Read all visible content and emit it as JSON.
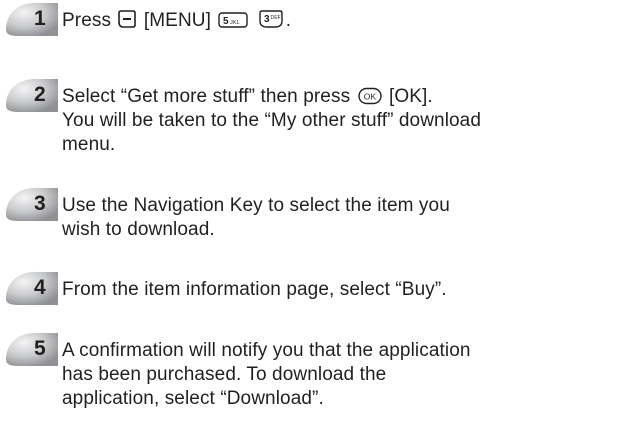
{
  "steps": [
    {
      "number": "1",
      "segments": {
        "before": "Press",
        "menu_label": "[MENU]",
        "end": "."
      },
      "keys": [
        "left-soft-key-icon",
        "5-jkl-key-icon",
        "3-def-key-icon"
      ],
      "key_glyphs": {
        "five": "5",
        "five_letters": "JKL",
        "three": "3",
        "three_letters": "DEF"
      }
    },
    {
      "number": "2",
      "segments": {
        "before": "Select “Get more stuff” then press",
        "ok_glyph": "OK",
        "after": "[OK]."
      },
      "lines": [
        "You will be taken to the “My other stuff” download",
        "menu."
      ],
      "keys": [
        "ok-key-icon"
      ]
    },
    {
      "number": "3",
      "lines": [
        "Use the Navigation Key to select the item you",
        "wish to download."
      ]
    },
    {
      "number": "4",
      "lines": [
        "From the item information page, select “Buy”."
      ]
    },
    {
      "number": "5",
      "lines": [
        "A confirmation will notify you that the application",
        "has been purchased. To download the",
        "application, select “Download”."
      ]
    }
  ],
  "colors": {
    "text": "#231f20",
    "badge_light": "#e6e7e8",
    "badge_mid": "#bcbec0",
    "badge_dark": "#939598"
  }
}
